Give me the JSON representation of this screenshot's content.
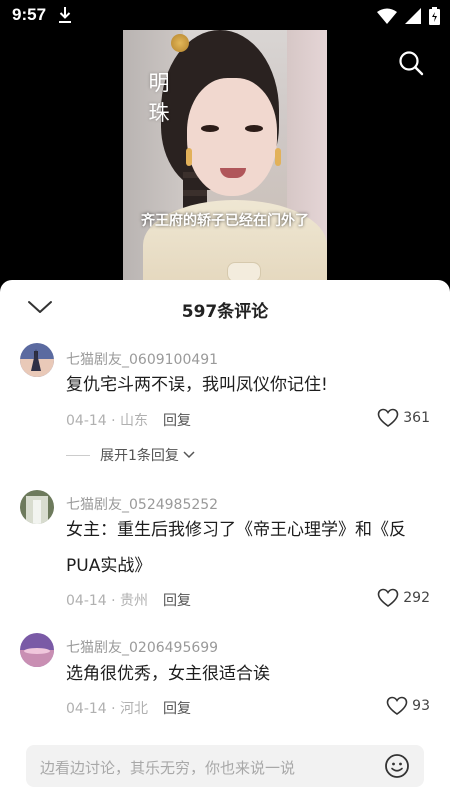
{
  "status_bar": {
    "time": "9:57"
  },
  "video": {
    "name_caption": "明\n珠",
    "subtitle": "齐王府的轿子已经在门外了"
  },
  "sheet": {
    "title": "597条评论"
  },
  "comments": [
    {
      "username": "七猫剧友_0609100491",
      "text": "复仇宅斗两不误，我叫凤仪你记住!",
      "meta": "04-14 · 山东",
      "reply_label": "回复",
      "likes": "361",
      "expand_label": "展开1条回复"
    },
    {
      "username": "七猫剧友_0524985252",
      "text": "女主：重生后我修习了《帝王心理学》和《反PUA实战》",
      "meta": "04-14 · 贵州",
      "reply_label": "回复",
      "likes": "292"
    },
    {
      "username": "七猫剧友_0206495699",
      "text": "选角很优秀，女主很适合诶",
      "meta": "04-14 · 河北",
      "reply_label": "回复",
      "likes": "93"
    }
  ],
  "input": {
    "placeholder": "边看边讨论，其乐无穷，你也来说一说"
  },
  "icons": [
    "download-icon",
    "wifi-icon",
    "signal-icon",
    "battery-icon",
    "search-icon",
    "chevron-down-icon",
    "heart-icon",
    "emoji-icon"
  ]
}
